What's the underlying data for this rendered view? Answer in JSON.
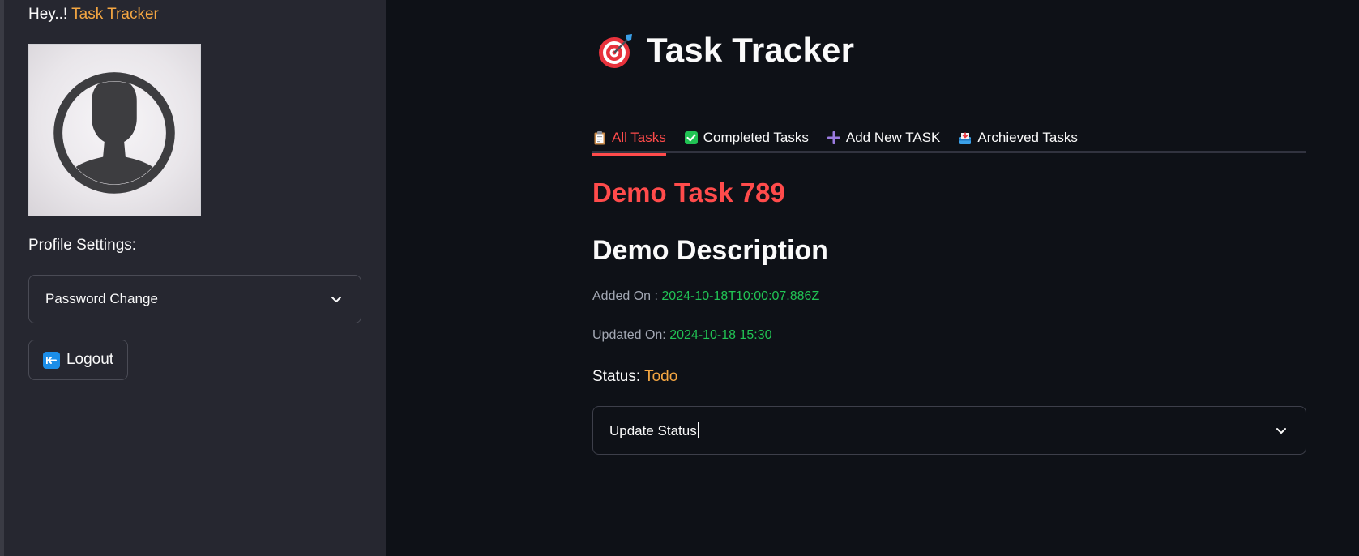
{
  "sidebar": {
    "greeting_prefix": "Hey..!",
    "greeting_name": "Task Tracker",
    "profile_settings_label": "Profile Settings:",
    "password_select_value": "Password Change",
    "logout_label": "Logout",
    "icons": {
      "avatar": "user-silhouette-icon",
      "chevron": "chevron-down-icon",
      "logout": "left-arrow-icon"
    }
  },
  "main": {
    "title": "Task Tracker",
    "title_icon": "target-dart-icon",
    "tabs": [
      {
        "label": "All Tasks",
        "icon": "clipboard-icon",
        "active": true
      },
      {
        "label": "Completed Tasks",
        "icon": "check-box-icon",
        "active": false
      },
      {
        "label": "Add New TASK",
        "icon": "plus-icon",
        "active": false
      },
      {
        "label": "Archieved Tasks",
        "icon": "inbox-tray-icon",
        "active": false
      }
    ],
    "task": {
      "title": "Demo Task 789",
      "description": "Demo Description",
      "added_label": "Added On :",
      "added_value": "2024-10-18T10:00:07.886Z",
      "updated_label": "Updated On:",
      "updated_value": "2024-10-18 15:30",
      "status_label": "Status:",
      "status_value": "Todo",
      "update_status_value": "Update Status"
    }
  },
  "colors": {
    "accent_red": "#ff4b4b",
    "accent_orange": "#f5a742",
    "accent_green": "#21c354",
    "sidebar_bg": "#262730",
    "main_bg": "#0e1117"
  }
}
